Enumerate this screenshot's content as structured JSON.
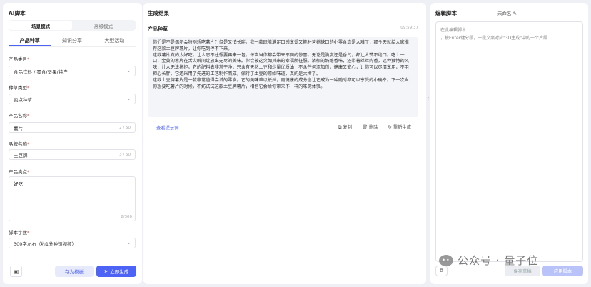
{
  "left": {
    "title": "AI脚本",
    "modes": [
      "场景模式",
      "高级模式"
    ],
    "tabs": [
      "产品种草",
      "知识分享",
      "大型活动"
    ],
    "category": {
      "label": "产品类目",
      "value": "食品饮料 / 零食/坚果/特产"
    },
    "seed_type": {
      "label": "种草类型",
      "value": "卖点种草"
    },
    "product_name": {
      "label": "产品名称",
      "value": "薯片",
      "count": "2 / 50"
    },
    "brand_name": {
      "label": "品牌名称",
      "value": "土豆牌",
      "count": "3 / 50"
    },
    "selling_point": {
      "label": "产品卖点",
      "value": "好吃",
      "count": "2/300"
    },
    "word_count": {
      "label": "脚本字数",
      "value": "300字左右（约1分钟短视频）"
    },
    "save_template": "存为模板",
    "generate": "立即生成"
  },
  "middle": {
    "title": "生成结果",
    "card_title": "产品种草",
    "time": "09:59:37",
    "paragraphs": [
      "你们是不是偶尔会特别想吃薯片？但是又怕长胖。我一款既能满足口感享受又能补营养缺口的小零食真是太难了，那今天就给大家推荐这款土豆牌薯片，让你吃到停不下来。",
      "这款薯片真的太好吃，让人忍不住想要再来一包。每次当你都会带来不同的惊喜，无论是脆度还是香气，都让人赞不绝口。吃上一口，金黄的薯片在舌尖瞬间绽放出无尽的美味。你会被这突如其来的幸福所征服。浓郁的奶酪香味，还带着丝丝肉香，这种独特的风味，让人无法抗拒。它的配料表非常干净，只含有天然土豆和少量优质油，不含任何添加剂，健康又安心，让你可以尽情享用，不用担心长胖。它还采用了先进的工艺制作而成，保持了土豆的原始味道，真的是太棒了。",
      "这款土豆牌薯片是一款非常值得尝试的零食。它的美味难以抵挡，而健康的成分也让它成为一种随时都可以享受的小确幸。下一次当你想要吃薯片的时候，不妨试试这款土豆牌薯片，相信它会给你带来不一样的味觉体验。"
    ],
    "view_prompt": "查看提示词",
    "copy": "复制",
    "delete": "删除",
    "regenerate": "重新生成"
  },
  "right": {
    "title": "编辑脚本",
    "script_name": "未命名",
    "placeholder_line1": "在此编辑脚本...",
    "placeholder_line2": "，按Enter键分段，一段文案对应\"3D生成\"中的一个片段",
    "save_script": "保存草稿",
    "use_script": "应用脚本"
  },
  "watermark": "公众号 · 量子位"
}
